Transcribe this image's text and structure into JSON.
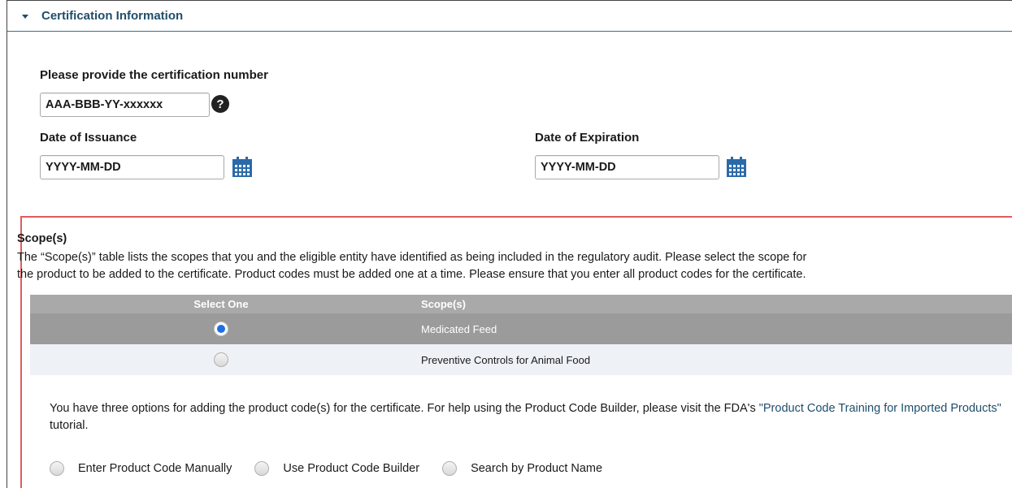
{
  "section": {
    "title": "Certification Information"
  },
  "certification": {
    "number_label": "Please provide the certification number",
    "number_value": "AAA-BBB-YY-xxxxxx",
    "help_glyph": "?"
  },
  "dates": {
    "issuance_label": "Date of Issuance",
    "issuance_value": "YYYY-MM-DD",
    "expiration_label": "Date of Expiration",
    "expiration_value": "YYYY-MM-DD"
  },
  "scope": {
    "title": "Scope(s)",
    "description_line1": "The “Scope(s)” table lists the scopes that you and the eligible entity have identified as being included in the regulatory audit. Please select the scope for",
    "description_line2": "the product to be added to the certificate. Product codes must be added one at a time. Please ensure that you enter all product codes for the certificate.",
    "table": {
      "headers": [
        "Select One",
        "Scope(s)"
      ],
      "rows": [
        {
          "label": "Medicated Feed",
          "selected": true
        },
        {
          "label": "Preventive Controls for Animal Food",
          "selected": false
        }
      ]
    }
  },
  "product_code": {
    "intro_before_link": "You have three options for adding the product code(s) for the certificate. For help using the Product Code Builder, please visit the FDA's ",
    "link_text": "\"Product Code Training for Imported Products\"",
    "intro_after_link": " tutorial.",
    "options": [
      {
        "label": "Enter Product Code Manually"
      },
      {
        "label": "Use Product Code Builder"
      },
      {
        "label": "Search by Product Name"
      }
    ]
  },
  "colors": {
    "accent": "#1f4e6b",
    "highlight_border": "#e05c5c",
    "selected_row": "#9b9b9b",
    "radio_selected": "#1f6fe0",
    "calendar": "#2b6aa8"
  },
  "icons": {
    "section_toggle": "chevron-down-icon",
    "help": "question-circle-icon",
    "calendar": "calendar-icon"
  }
}
